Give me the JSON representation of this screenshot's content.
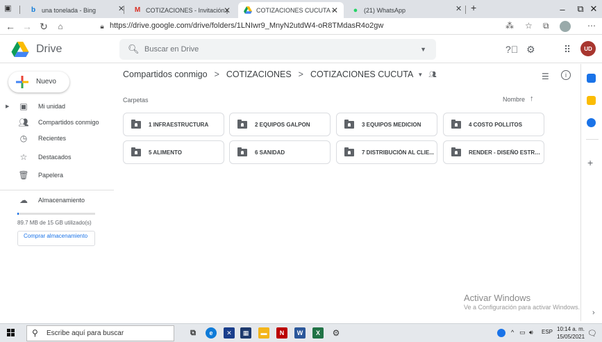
{
  "browser": {
    "tabs": [
      {
        "title": "una tonelada - Bing",
        "icon": "bing-icon"
      },
      {
        "title": "COTIZACIONES - Invitación para",
        "icon": "gmail-icon"
      },
      {
        "title": "COTIZACIONES CUCUTA - Goog",
        "icon": "drive-icon",
        "active": true
      },
      {
        "title": "(21) WhatsApp",
        "icon": "whatsapp-icon"
      }
    ],
    "url": "https://drive.google.com/drive/folders/1LNIwr9_MnyN2utdW4-oR8TMdasR4o2gw",
    "window_controls": {
      "minimize": "–",
      "maximize": "⧉",
      "close": "✕"
    }
  },
  "drive": {
    "brand": "Drive",
    "search_placeholder": "Buscar en Drive",
    "new_button": "Nuevo",
    "nav": [
      {
        "label": "Mi unidad",
        "icon": "my-drive-icon"
      },
      {
        "label": "Compartidos conmigo",
        "icon": "shared-icon"
      },
      {
        "label": "Recientes",
        "icon": "clock-icon"
      },
      {
        "label": "Destacados",
        "icon": "star-icon"
      },
      {
        "label": "Papelera",
        "icon": "trash-icon"
      }
    ],
    "storage": {
      "label": "Almacenamiento",
      "usage": "89.7 MB de 15 GB utilizado(s)",
      "used_fraction": 0.006,
      "buy_button": "Comprar almacenamiento"
    }
  },
  "main": {
    "breadcrumb": [
      "Compartidos conmigo",
      "COTIZACIONES",
      "COTIZACIONES CUCUTA"
    ],
    "section_label": "Carpetas",
    "sort_label": "Nombre",
    "folders": [
      "1 INFRAESTRUCTURA",
      "2 EQUIPOS GALPON",
      "3 EQUIPOS MEDICION",
      "4 COSTO POLLITOS",
      "5 ALIMENTO",
      "6 SANIDAD",
      "7 DISTRIBUCIÓN AL CLIE...",
      "RENDER - DISEÑO ESTRU..."
    ]
  },
  "watermark": {
    "line1": "Activar Windows",
    "line2": "Ve a Configuración para activar Windows."
  },
  "taskbar": {
    "search_placeholder": "Escribe aquí para buscar",
    "language": "ESP",
    "time": "10:14 a. m.",
    "date": "15/05/2021"
  }
}
